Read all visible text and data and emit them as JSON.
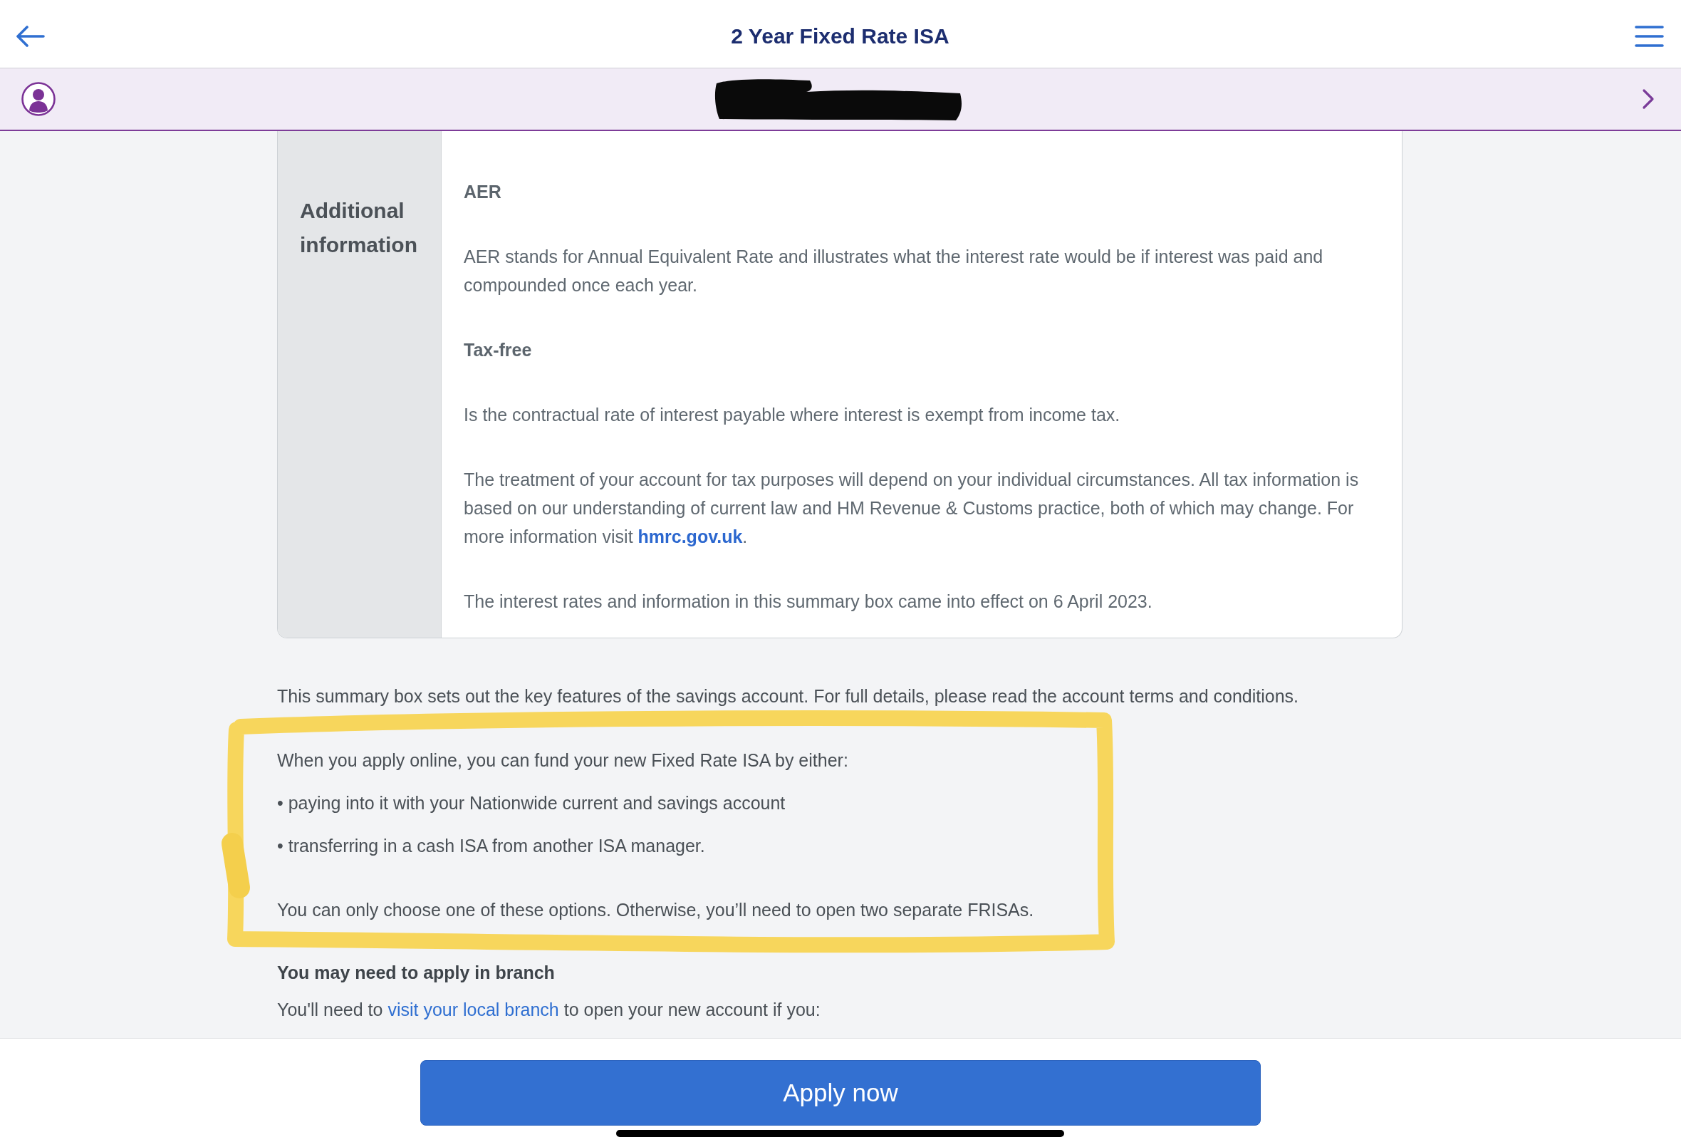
{
  "nav_bar": {
    "title": "2 Year Fixed Rate ISA"
  },
  "member_bar": {
    "redacted": true
  },
  "summary_table": {
    "rows": [
      {
        "label": "Additional information",
        "content": [
          {
            "kind": "heading",
            "text": "AER"
          },
          {
            "kind": "paragraph",
            "text": "AER stands for Annual Equivalent Rate and illustrates what the interest rate would be if interest was paid and compounded once each year."
          },
          {
            "kind": "heading",
            "text": "Tax-free"
          },
          {
            "kind": "paragraph",
            "text": "Is the contractual rate of interest payable where interest is exempt from income tax."
          },
          {
            "kind": "paragraph",
            "text": "The treatment of your account for tax purposes will depend on your individual circumstances. All tax information is based on our understanding of current law and HM Revenue & Customs practice, both of which may change. For more information visit",
            "link": "hmrc.gov.uk",
            "after": "."
          },
          {
            "kind": "paragraph",
            "text": "The interest rates and information in this summary box came into effect on 6 April 2023."
          }
        ]
      }
    ]
  },
  "summary_note": "This summary box sets out the key features of the savings account. For full details, please read the account terms and conditions.",
  "funding": {
    "intro": "When you apply online, you can fund your new Fixed Rate ISA by either:",
    "options": [
      "• paying into it with your Nationwide current and savings account",
      "• transferring in a cash ISA from another ISA manager."
    ],
    "note": "You can only choose one of these options. Otherwise, you’ll need to open two separate FRISAs."
  },
  "annotation": {
    "kind": "marker-outline"
  },
  "branch": {
    "heading": "You may need to apply in branch",
    "text_before": "You'll need to",
    "link": "visit your local branch",
    "text_after": "to open your new account if you:"
  },
  "footer": {
    "button": "Apply now"
  }
}
